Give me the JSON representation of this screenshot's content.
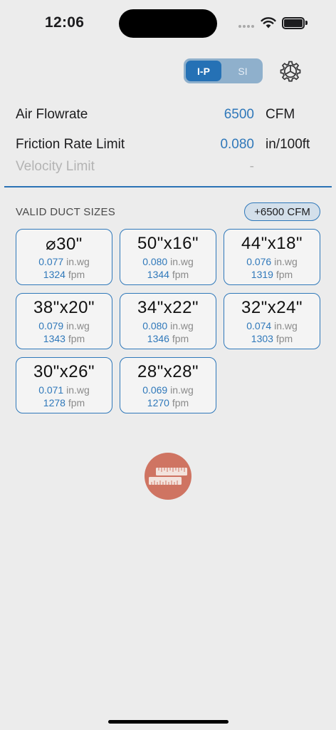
{
  "status_bar": {
    "time": "12:06"
  },
  "unit_toggle": {
    "ip_label": "I-P",
    "si_label": "SI",
    "selected": "I-P"
  },
  "inputs": {
    "air_flowrate": {
      "label": "Air Flowrate",
      "value": "6500",
      "unit": "CFM"
    },
    "friction_rate": {
      "label": "Friction Rate Limit",
      "value": "0.080",
      "unit": "in/100ft"
    },
    "velocity": {
      "label": "Velocity Limit",
      "value": "-"
    }
  },
  "results": {
    "title": "VALID DUCT SIZES",
    "flow_badge": "+6500 CFM",
    "cards": [
      {
        "size": "⌀30\"",
        "friction": "0.077",
        "friction_unit": "in.wg",
        "velocity": "1324",
        "velocity_unit": "fpm"
      },
      {
        "size": "50\"x16\"",
        "friction": "0.080",
        "friction_unit": "in.wg",
        "velocity": "1344",
        "velocity_unit": "fpm"
      },
      {
        "size": "44\"x18\"",
        "friction": "0.076",
        "friction_unit": "in.wg",
        "velocity": "1319",
        "velocity_unit": "fpm"
      },
      {
        "size": "38\"x20\"",
        "friction": "0.079",
        "friction_unit": "in.wg",
        "velocity": "1343",
        "velocity_unit": "fpm"
      },
      {
        "size": "34\"x22\"",
        "friction": "0.080",
        "friction_unit": "in.wg",
        "velocity": "1346",
        "velocity_unit": "fpm"
      },
      {
        "size": "32\"x24\"",
        "friction": "0.074",
        "friction_unit": "in.wg",
        "velocity": "1303",
        "velocity_unit": "fpm"
      },
      {
        "size": "30\"x26\"",
        "friction": "0.071",
        "friction_unit": "in.wg",
        "velocity": "1278",
        "velocity_unit": "fpm"
      },
      {
        "size": "28\"x28\"",
        "friction": "0.069",
        "friction_unit": "in.wg",
        "velocity": "1270",
        "velocity_unit": "fpm"
      }
    ]
  },
  "icons": {
    "settings": "gear-icon",
    "fab": "ruler-icon",
    "wifi": "wifi-icon",
    "battery": "battery-icon"
  },
  "colors": {
    "accent": "#2f78ba",
    "toggle_selected": "#2571b5",
    "fab": "#cf7462",
    "background": "#ececec"
  }
}
